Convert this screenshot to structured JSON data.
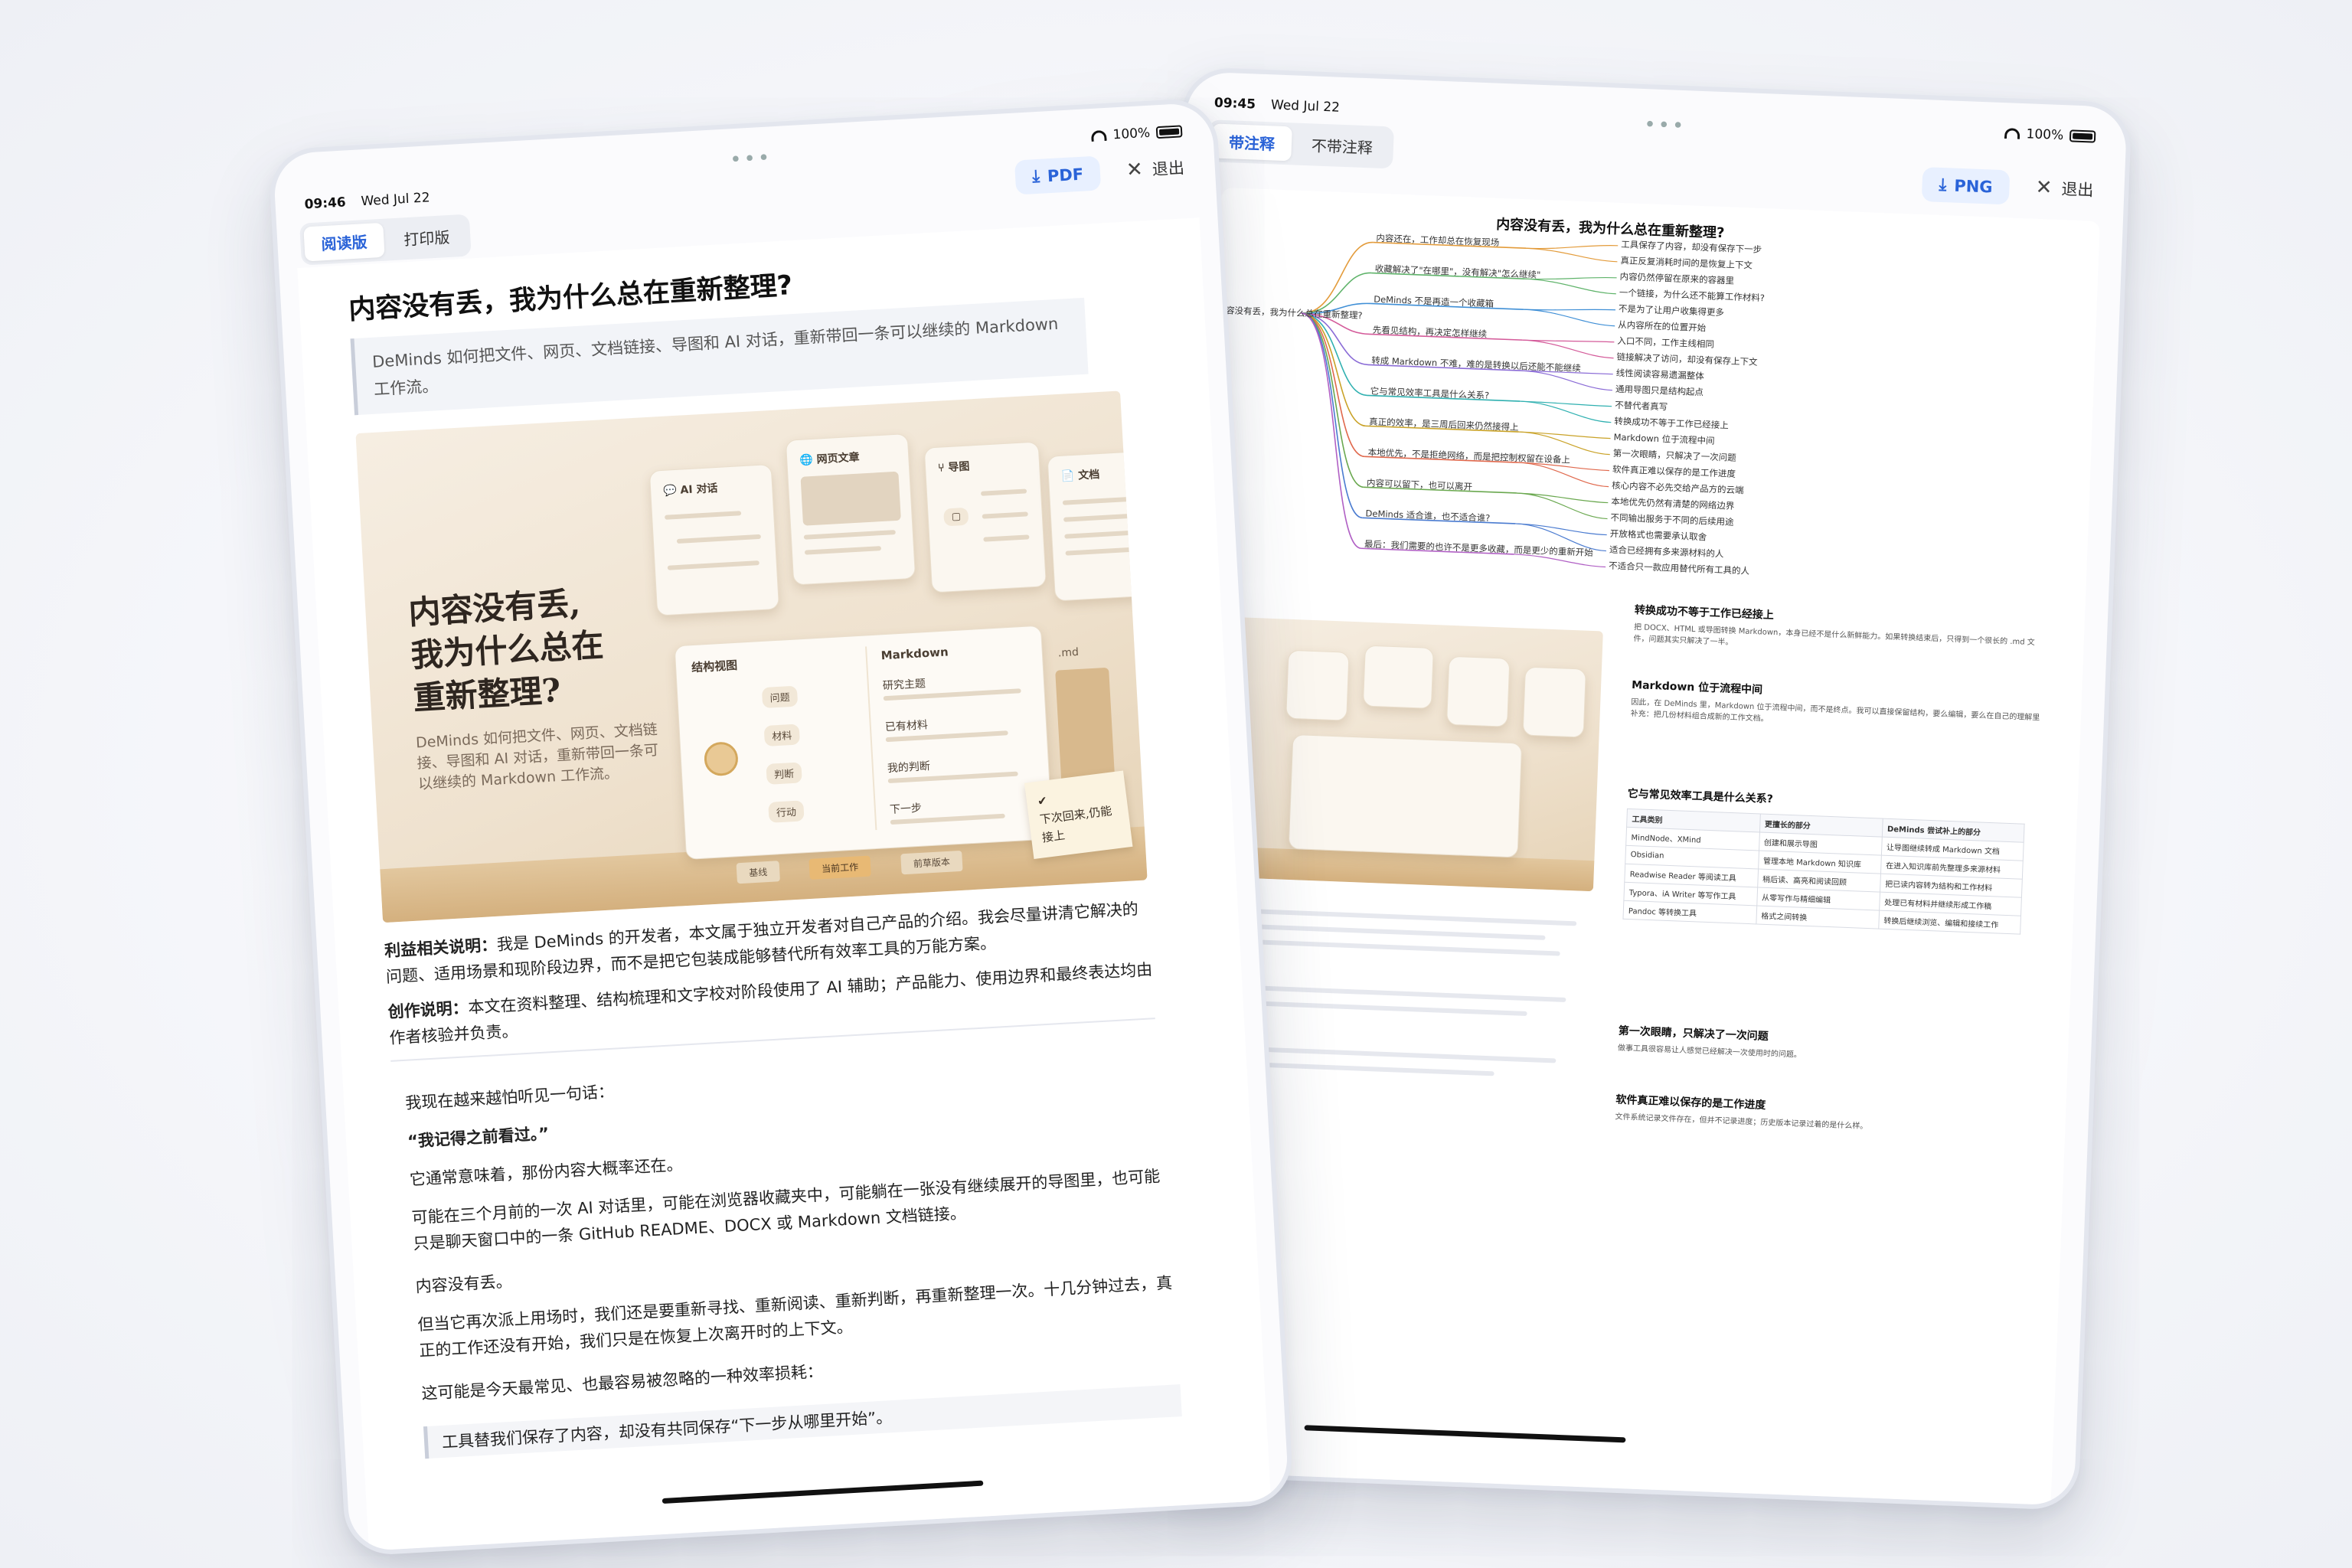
{
  "left_tablet": {
    "status": {
      "time": "09:46",
      "date": "Wed Jul 22",
      "battery": "100%"
    },
    "tabs": [
      {
        "label": "阅读版",
        "active": true
      },
      {
        "label": "打印版",
        "active": false
      }
    ],
    "download_label": "PDF",
    "exit_label": "退出",
    "article": {
      "title": "内容没有丢，我为什么总在重新整理?",
      "summary": "DeMinds 如何把文件、网页、文档链接、导图和 AI 对话，重新带回一条可以继续的 Markdown 工作流。",
      "hero": {
        "title_lines": [
          "内容没有丢,",
          "我为什么总在",
          "重新整理?"
        ],
        "subtitle": "DeMinds 如何把文件、网页、文档链接、导图和 AI 对话，重新带回一条可以继续的 Markdown 工作流。",
        "cards": {
          "ai": "AI 对话",
          "web": "网页文章",
          "mindmap": "导图",
          "doc": "文档"
        },
        "structure_title": "结构视图",
        "markdown_title": "Markdown",
        "md_ext": ".md",
        "nodes": [
          "问题",
          "材料",
          "判断",
          "行动"
        ],
        "md_sections": [
          "研究主题",
          "已有材料",
          "我的判断",
          "下一步"
        ],
        "bottom_tabs": [
          "基线",
          "当前工作",
          "前草版本"
        ],
        "note": "下次回来,仍能接上"
      },
      "disclosure_label": "利益相关说明：",
      "disclosure_text": "我是 DeMinds 的开发者，本文属于独立开发者对自己产品的介绍。我会尽量讲清它解决的问题、适用场景和现阶段边界，而不是把它包装成能够替代所有效率工具的万能方案。",
      "creation_label": "创作说明：",
      "creation_text": "本文在资料整理、结构梳理和文字校对阶段使用了 AI 辅助；产品能力、使用边界和最终表达均由作者核验并负责。",
      "body": [
        "我现在越来越怕听见一句话：",
        "“我记得之前看过。”",
        "它通常意味着，那份内容大概率还在。",
        "可能在三个月前的一次 AI 对话里，可能在浏览器收藏夹中，可能躺在一张没有继续展开的导图里，也可能只是聊天窗口中的一条 GitHub README、DOCX 或 Markdown 文档链接。",
        "内容没有丢。",
        "但当它再次派上用场时，我们还是要重新寻找、重新阅读、重新判断，再重新整理一次。十几分钟过去，真正的工作还没有开始，我们只是在恢复上次离开时的上下文。",
        "这可能是今天最常见、也最容易被忽略的一种效率损耗："
      ],
      "last_quote": "工具替我们保存了内容，却没有共同保存“下一步从哪里开始”。"
    }
  },
  "right_tablet": {
    "status": {
      "time": "09:45",
      "date": "Wed Jul 22",
      "battery": "100%"
    },
    "tabs": [
      {
        "label": "带注释",
        "active": true
      },
      {
        "label": "不带注释",
        "active": false
      }
    ],
    "download_label": "PNG",
    "exit_label": "退出",
    "title": "内容没有丢，我为什么总在重新整理?",
    "mindmap_root": "内容没有丢，我为什么总在重新整理?",
    "mindmap_branches": [
      "内容还在，工作却总在恢复现场",
      "收藏解决了\"在哪里\"，没有解决\"怎么继续\"",
      "DeMinds 不是再造一个收藏箱",
      "先看见结构，再决定怎样继续",
      "转成 Markdown 不难，难的是转换以后还能不能继续",
      "它与常见效率工具是什么关系?",
      "真正的效率，是三周后回来仍然接得上",
      "本地优先，不是拒绝网络，而是把控制权留在设备上",
      "内容可以留下，也可以离开",
      "DeMinds 适合谁，也不适合谁?",
      "最后：我们需要的也许不是更多收藏，而是更少的重新开始"
    ],
    "mindmap_leaves": [
      "工具保存了内容，却没有保存下一步",
      "真正反复消耗时间的是恢复上下文",
      "内容仍然停留在原来的容器里",
      "一个链接，为什么还不能算工作材料?",
      "不是为了让用户收集得更多",
      "从内容所在的位置开始",
      "入口不同，工作主线相同",
      "链接解决了访问，却没有保存上下文",
      "线性阅读容易遗漏整体",
      "通用导图只是结构起点",
      "不替代者真写",
      "转换成功不等于工作已经接上",
      "Markdown 位于流程中间",
      "第一次眼睛，只解决了一次问题",
      "软件真正难以保存的是工作进度",
      "核心内容不必先交给产品方的云端",
      "本地优先仍然有清楚的网络边界",
      "不同输出服务于不同的后续用途",
      "开放格式也需要承认取舍",
      "适合已经拥有多来源材料的人",
      "不适合只一款应用替代所有工具的人"
    ],
    "sections": [
      {
        "heading": "转换成功不等于工作已经接上",
        "text": "把 DOCX、HTML 或导图转换 Markdown，本身已经不是什么新鲜能力。如果转换结束后，只得到一个很长的 .md 文件，问题其实只解决了一半。"
      },
      {
        "heading": "Markdown 位于流程中间",
        "text": "因此，在 DeMinds 里，Markdown 位于流程中间，而不是终点。我可以直接保留结构，要么编辑，要么在自己的理解里补充：把几份材料组合成新的工作文档。"
      },
      {
        "heading": "它与常见效率工具是什么关系?",
        "text": ""
      },
      {
        "heading": "第一次眼睛，只解决了一次问题",
        "text": "做事工具很容易让人感觉已经解决一次使用时的问题。"
      },
      {
        "heading": "软件真正难以保存的是工作进度",
        "text": "文件系统记录文件存在，但并不记录进度；历史版本记录过着的是什么样。"
      }
    ],
    "table": {
      "headers": [
        "工具类别",
        "更擅长的部分",
        "DeMinds 尝试补上的部分"
      ],
      "rows": [
        [
          "MindNode、XMind",
          "创建和展示导图",
          "让导图继续转成 Markdown 文档"
        ],
        [
          "Obsidian",
          "管理本地 Markdown 知识库",
          "在进入知识库前先整理多来源材料"
        ],
        [
          "Readwise Reader 等阅读工具",
          "稍后读、高亮和阅读回顾",
          "把已读内容转为结构和工作材料"
        ],
        [
          "Typora、iA Writer 等写作工具",
          "从零写作与精细编辑",
          "处理已有材料并继续形成工作稿"
        ],
        [
          "Pandoc 等转换工具",
          "格式之间转换",
          "转换后继续浏览、编辑和接续工作"
        ]
      ]
    }
  }
}
